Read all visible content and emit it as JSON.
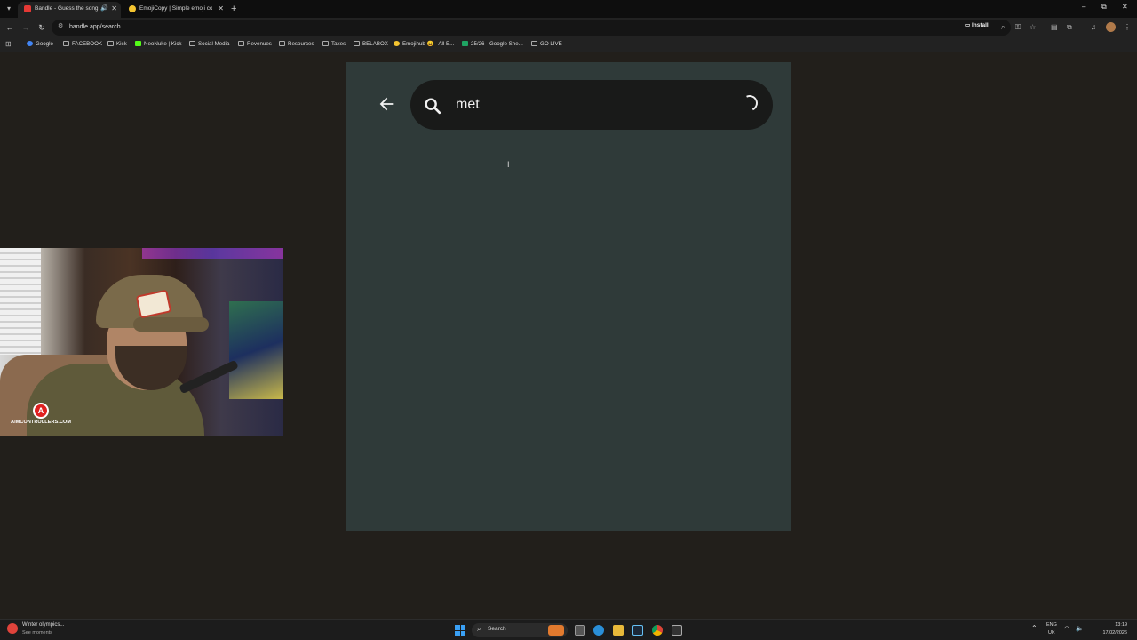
{
  "browser": {
    "tabs": [
      {
        "title": "Bandle - Guess the song, o",
        "active": true,
        "audio_icon": "speaker-icon"
      },
      {
        "title": "EmojiCopy | Simple emoji copy",
        "active": false
      }
    ],
    "new_tab_label": "+",
    "window_controls": {
      "minimize": "–",
      "restore": "⧉",
      "close": "✕"
    },
    "nav": {
      "back": "←",
      "forward": "→",
      "reload": "↻"
    },
    "url": "bandle.app/search",
    "install_label": "Install",
    "bookmarks": [
      {
        "label": "Google",
        "icon": "google-icon"
      },
      {
        "label": "FACEBOOK",
        "icon": "folder-icon"
      },
      {
        "label": "Kick",
        "icon": "folder-icon"
      },
      {
        "label": "NeoNuke | Kick",
        "icon": "kick-icon"
      },
      {
        "label": "Social Media",
        "icon": "folder-icon"
      },
      {
        "label": "Revenues",
        "icon": "folder-icon"
      },
      {
        "label": "Resources",
        "icon": "folder-icon"
      },
      {
        "label": "Taxes",
        "icon": "folder-icon"
      },
      {
        "label": "BELABOX",
        "icon": "folder-icon"
      },
      {
        "label": "Emojihub 😄 - All E...",
        "icon": "emoji-icon"
      },
      {
        "label": "25/26 - Google She...",
        "icon": "sheets-icon"
      },
      {
        "label": "GO LIVE",
        "icon": "folder-icon"
      }
    ]
  },
  "search": {
    "query": "met",
    "back_icon": "arrow-left-icon",
    "search_icon": "search-icon",
    "loading": true
  },
  "webcam": {
    "logo_letter": "A",
    "logo_text": "AIMCONTROLLERS.COM"
  },
  "taskbar": {
    "weather_title": "Winter olympics...",
    "weather_sub": "See moments",
    "search_label": "Search",
    "lang_line1": "ENG",
    "lang_line2": "UK",
    "time": "13:19",
    "date": "17/02/2026"
  },
  "colors": {
    "page_bg": "#221f1b",
    "panel_bg": "#2f3a39",
    "searchbar_bg": "#191a19",
    "start_blue": "#3aa0f5"
  }
}
